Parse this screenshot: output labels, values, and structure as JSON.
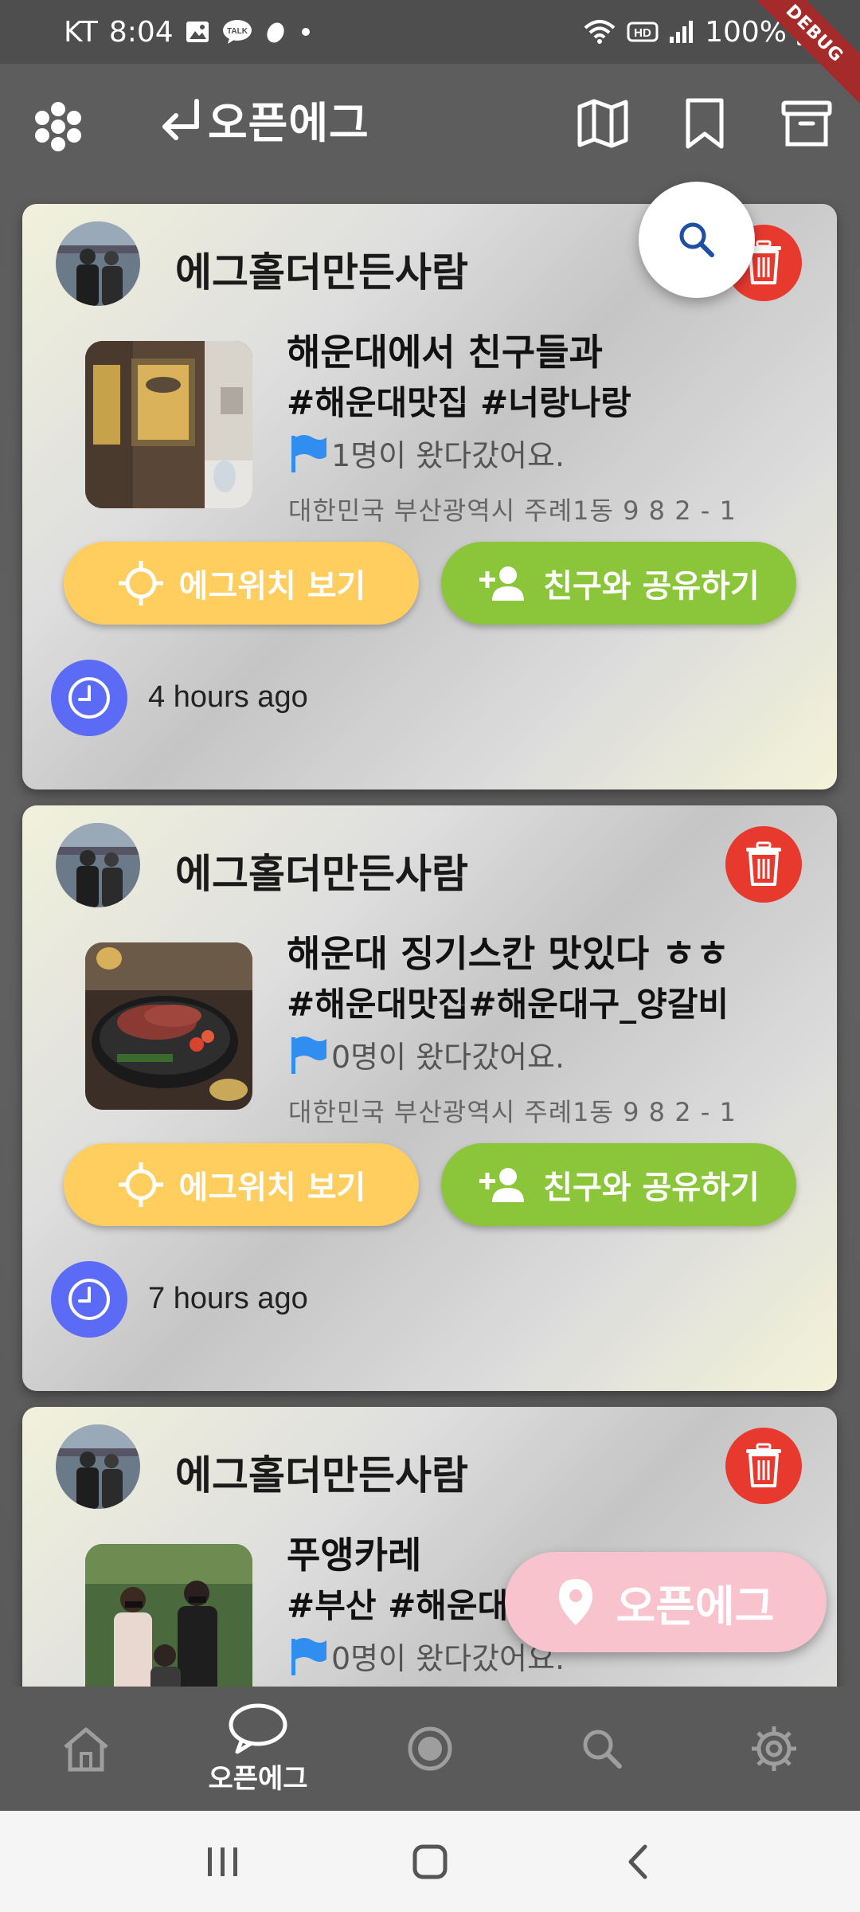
{
  "status_bar": {
    "carrier": "KT",
    "time": "8:04",
    "talk_badge": "TALK",
    "hd_badge": "HD",
    "battery": "100%",
    "debug_label": "DEBUG"
  },
  "app_bar": {
    "title": "오픈에그",
    "icons": [
      "menu-dots-icon",
      "back-arrow-icon",
      "map-icon",
      "bookmark-icon",
      "archive-icon"
    ]
  },
  "posts": [
    {
      "author": "에그홀더만든사람",
      "title": "해운대에서 친구들과",
      "tags": "#해운대맛집 #너랑나랑",
      "visits": "1명이 왔다갔어요.",
      "address": "대한민국 부산광역시 주례1동 9 8 2 - 1",
      "location_button": "에그위치 보기",
      "share_button": "친구와 공유하기",
      "time_ago": "4 hours ago"
    },
    {
      "author": "에그홀더만든사람",
      "title": "해운대 징기스칸 맛있다 ㅎㅎ",
      "tags": "#해운대맛집#해운대구_양갈비",
      "visits": "0명이 왔다갔어요.",
      "address": "대한민국 부산광역시 주례1동 9 8 2 - 1",
      "location_button": "에그위치 보기",
      "share_button": "친구와 공유하기",
      "time_ago": "7 hours ago"
    },
    {
      "author": "에그홀더만든사람",
      "title": "푸앵카레",
      "tags": "#부산 #해운대",
      "visits": "0명이 왔다갔어요."
    }
  ],
  "fab": {
    "open_egg_label": "오픈에그"
  },
  "bottom_nav": {
    "items": [
      {
        "icon": "home-icon",
        "label": ""
      },
      {
        "icon": "chat-bubble-icon",
        "label": "오픈에그"
      },
      {
        "icon": "record-icon",
        "label": ""
      },
      {
        "icon": "search-icon",
        "label": ""
      },
      {
        "icon": "settings-icon",
        "label": ""
      }
    ]
  },
  "colors": {
    "delete": "#e8392f",
    "location_button": "#ffce5e",
    "share_button": "#8bc53a",
    "clock": "#5c6bf5",
    "open_egg_fab": "#f9c3cd",
    "flag": "#2f8ef0"
  }
}
